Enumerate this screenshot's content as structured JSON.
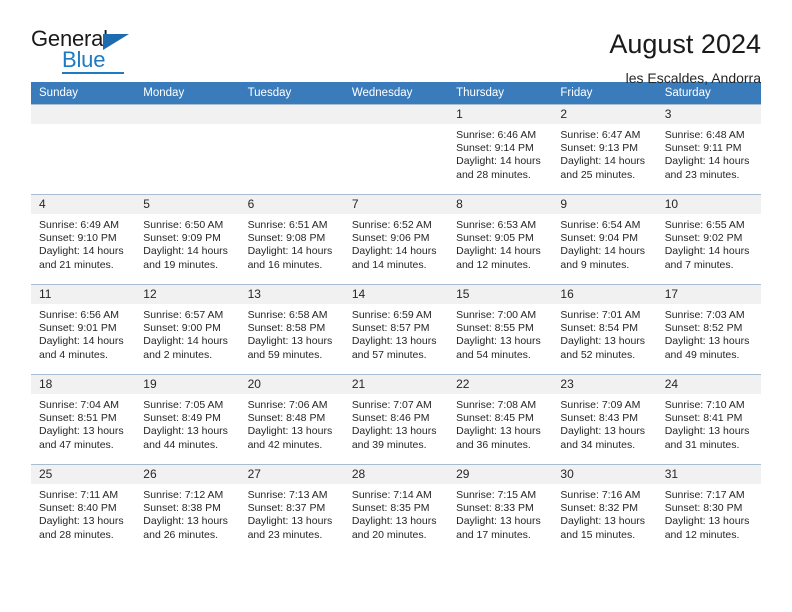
{
  "logo": {
    "word_one": "General",
    "word_two": "Blue",
    "triangle_color": "#1f6bb0",
    "blue_color": "#1f7ac4"
  },
  "header": {
    "title": "August 2024",
    "subtitle": "les Escaldes, Andorra",
    "header_bg": "#3a7cbb",
    "daynum_bg": "#f1f1f1"
  },
  "weekdays": [
    "Sunday",
    "Monday",
    "Tuesday",
    "Wednesday",
    "Thursday",
    "Friday",
    "Saturday"
  ],
  "labels": {
    "sunrise": "Sunrise:",
    "sunset": "Sunset:",
    "daylight": "Daylight:"
  },
  "weeks": [
    [
      {
        "day": "",
        "sunrise": "",
        "sunset": "",
        "daylight_a": "",
        "daylight_b": ""
      },
      {
        "day": "",
        "sunrise": "",
        "sunset": "",
        "daylight_a": "",
        "daylight_b": ""
      },
      {
        "day": "",
        "sunrise": "",
        "sunset": "",
        "daylight_a": "",
        "daylight_b": ""
      },
      {
        "day": "",
        "sunrise": "",
        "sunset": "",
        "daylight_a": "",
        "daylight_b": ""
      },
      {
        "day": "1",
        "sunrise": "Sunrise: 6:46 AM",
        "sunset": "Sunset: 9:14 PM",
        "daylight_a": "Daylight: 14 hours",
        "daylight_b": "and 28 minutes."
      },
      {
        "day": "2",
        "sunrise": "Sunrise: 6:47 AM",
        "sunset": "Sunset: 9:13 PM",
        "daylight_a": "Daylight: 14 hours",
        "daylight_b": "and 25 minutes."
      },
      {
        "day": "3",
        "sunrise": "Sunrise: 6:48 AM",
        "sunset": "Sunset: 9:11 PM",
        "daylight_a": "Daylight: 14 hours",
        "daylight_b": "and 23 minutes."
      }
    ],
    [
      {
        "day": "4",
        "sunrise": "Sunrise: 6:49 AM",
        "sunset": "Sunset: 9:10 PM",
        "daylight_a": "Daylight: 14 hours",
        "daylight_b": "and 21 minutes."
      },
      {
        "day": "5",
        "sunrise": "Sunrise: 6:50 AM",
        "sunset": "Sunset: 9:09 PM",
        "daylight_a": "Daylight: 14 hours",
        "daylight_b": "and 19 minutes."
      },
      {
        "day": "6",
        "sunrise": "Sunrise: 6:51 AM",
        "sunset": "Sunset: 9:08 PM",
        "daylight_a": "Daylight: 14 hours",
        "daylight_b": "and 16 minutes."
      },
      {
        "day": "7",
        "sunrise": "Sunrise: 6:52 AM",
        "sunset": "Sunset: 9:06 PM",
        "daylight_a": "Daylight: 14 hours",
        "daylight_b": "and 14 minutes."
      },
      {
        "day": "8",
        "sunrise": "Sunrise: 6:53 AM",
        "sunset": "Sunset: 9:05 PM",
        "daylight_a": "Daylight: 14 hours",
        "daylight_b": "and 12 minutes."
      },
      {
        "day": "9",
        "sunrise": "Sunrise: 6:54 AM",
        "sunset": "Sunset: 9:04 PM",
        "daylight_a": "Daylight: 14 hours",
        "daylight_b": "and 9 minutes."
      },
      {
        "day": "10",
        "sunrise": "Sunrise: 6:55 AM",
        "sunset": "Sunset: 9:02 PM",
        "daylight_a": "Daylight: 14 hours",
        "daylight_b": "and 7 minutes."
      }
    ],
    [
      {
        "day": "11",
        "sunrise": "Sunrise: 6:56 AM",
        "sunset": "Sunset: 9:01 PM",
        "daylight_a": "Daylight: 14 hours",
        "daylight_b": "and 4 minutes."
      },
      {
        "day": "12",
        "sunrise": "Sunrise: 6:57 AM",
        "sunset": "Sunset: 9:00 PM",
        "daylight_a": "Daylight: 14 hours",
        "daylight_b": "and 2 minutes."
      },
      {
        "day": "13",
        "sunrise": "Sunrise: 6:58 AM",
        "sunset": "Sunset: 8:58 PM",
        "daylight_a": "Daylight: 13 hours",
        "daylight_b": "and 59 minutes."
      },
      {
        "day": "14",
        "sunrise": "Sunrise: 6:59 AM",
        "sunset": "Sunset: 8:57 PM",
        "daylight_a": "Daylight: 13 hours",
        "daylight_b": "and 57 minutes."
      },
      {
        "day": "15",
        "sunrise": "Sunrise: 7:00 AM",
        "sunset": "Sunset: 8:55 PM",
        "daylight_a": "Daylight: 13 hours",
        "daylight_b": "and 54 minutes."
      },
      {
        "day": "16",
        "sunrise": "Sunrise: 7:01 AM",
        "sunset": "Sunset: 8:54 PM",
        "daylight_a": "Daylight: 13 hours",
        "daylight_b": "and 52 minutes."
      },
      {
        "day": "17",
        "sunrise": "Sunrise: 7:03 AM",
        "sunset": "Sunset: 8:52 PM",
        "daylight_a": "Daylight: 13 hours",
        "daylight_b": "and 49 minutes."
      }
    ],
    [
      {
        "day": "18",
        "sunrise": "Sunrise: 7:04 AM",
        "sunset": "Sunset: 8:51 PM",
        "daylight_a": "Daylight: 13 hours",
        "daylight_b": "and 47 minutes."
      },
      {
        "day": "19",
        "sunrise": "Sunrise: 7:05 AM",
        "sunset": "Sunset: 8:49 PM",
        "daylight_a": "Daylight: 13 hours",
        "daylight_b": "and 44 minutes."
      },
      {
        "day": "20",
        "sunrise": "Sunrise: 7:06 AM",
        "sunset": "Sunset: 8:48 PM",
        "daylight_a": "Daylight: 13 hours",
        "daylight_b": "and 42 minutes."
      },
      {
        "day": "21",
        "sunrise": "Sunrise: 7:07 AM",
        "sunset": "Sunset: 8:46 PM",
        "daylight_a": "Daylight: 13 hours",
        "daylight_b": "and 39 minutes."
      },
      {
        "day": "22",
        "sunrise": "Sunrise: 7:08 AM",
        "sunset": "Sunset: 8:45 PM",
        "daylight_a": "Daylight: 13 hours",
        "daylight_b": "and 36 minutes."
      },
      {
        "day": "23",
        "sunrise": "Sunrise: 7:09 AM",
        "sunset": "Sunset: 8:43 PM",
        "daylight_a": "Daylight: 13 hours",
        "daylight_b": "and 34 minutes."
      },
      {
        "day": "24",
        "sunrise": "Sunrise: 7:10 AM",
        "sunset": "Sunset: 8:41 PM",
        "daylight_a": "Daylight: 13 hours",
        "daylight_b": "and 31 minutes."
      }
    ],
    [
      {
        "day": "25",
        "sunrise": "Sunrise: 7:11 AM",
        "sunset": "Sunset: 8:40 PM",
        "daylight_a": "Daylight: 13 hours",
        "daylight_b": "and 28 minutes."
      },
      {
        "day": "26",
        "sunrise": "Sunrise: 7:12 AM",
        "sunset": "Sunset: 8:38 PM",
        "daylight_a": "Daylight: 13 hours",
        "daylight_b": "and 26 minutes."
      },
      {
        "day": "27",
        "sunrise": "Sunrise: 7:13 AM",
        "sunset": "Sunset: 8:37 PM",
        "daylight_a": "Daylight: 13 hours",
        "daylight_b": "and 23 minutes."
      },
      {
        "day": "28",
        "sunrise": "Sunrise: 7:14 AM",
        "sunset": "Sunset: 8:35 PM",
        "daylight_a": "Daylight: 13 hours",
        "daylight_b": "and 20 minutes."
      },
      {
        "day": "29",
        "sunrise": "Sunrise: 7:15 AM",
        "sunset": "Sunset: 8:33 PM",
        "daylight_a": "Daylight: 13 hours",
        "daylight_b": "and 17 minutes."
      },
      {
        "day": "30",
        "sunrise": "Sunrise: 7:16 AM",
        "sunset": "Sunset: 8:32 PM",
        "daylight_a": "Daylight: 13 hours",
        "daylight_b": "and 15 minutes."
      },
      {
        "day": "31",
        "sunrise": "Sunrise: 7:17 AM",
        "sunset": "Sunset: 8:30 PM",
        "daylight_a": "Daylight: 13 hours",
        "daylight_b": "and 12 minutes."
      }
    ]
  ]
}
